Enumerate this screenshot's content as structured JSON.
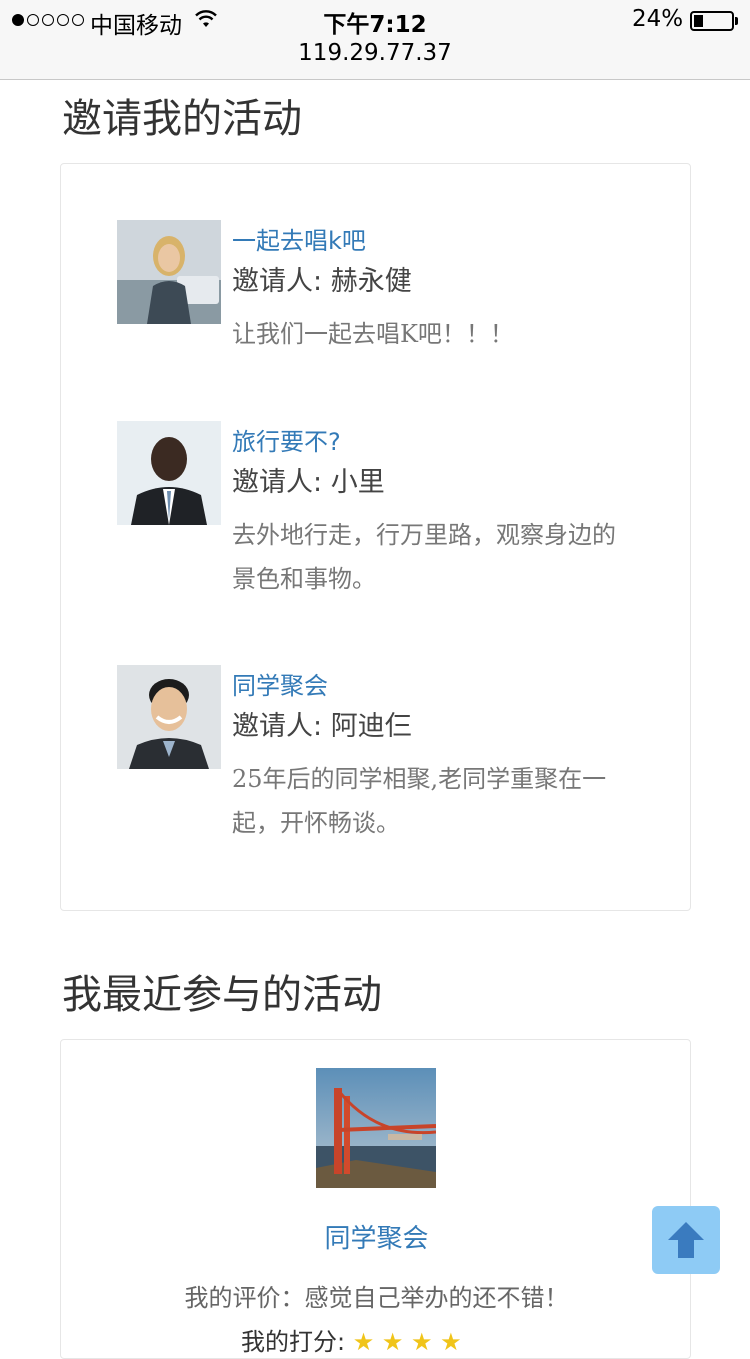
{
  "status": {
    "carrier": "中国移动",
    "time": "下午7:12",
    "battery": "24%",
    "url": "119.29.77.37"
  },
  "invite_section": {
    "title": "邀请我的活动",
    "items": [
      {
        "title": "一起去唱k吧",
        "inviter_label": "邀请人:",
        "inviter": "赫永健",
        "description": "让我们一起去唱K吧！！！"
      },
      {
        "title": "旅行要不?",
        "inviter_label": "邀请人:",
        "inviter": "小里",
        "description": "去外地行走，行万里路，观察身边的景色和事物。"
      },
      {
        "title": "同学聚会",
        "inviter_label": "邀请人:",
        "inviter": "阿迪仨",
        "description": "25年后的同学相聚,老同学重聚在一起，开怀畅谈。"
      }
    ]
  },
  "recent_section": {
    "title": "我最近参与的活动",
    "item": {
      "title": "同学聚会",
      "review": "我的评价：感觉自己举办的还不错！",
      "rating_label": "我的打分:",
      "stars": "★ ★ ★ ★"
    }
  },
  "colors": {
    "link": "#337ab7",
    "back_to_top": "#8ecbf5",
    "star": "#f0c419"
  },
  "icons": [
    "wifi-icon",
    "battery-icon",
    "arrow-up-icon"
  ]
}
